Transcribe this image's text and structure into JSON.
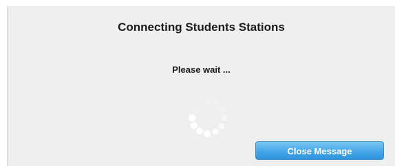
{
  "dialog": {
    "title": "Connecting Students Stations",
    "message": "Please wait ...",
    "spinner_icon": "loading-spinner-icon",
    "close_button_label": "Close Message"
  },
  "colors": {
    "dialog_background": "#efefef",
    "button_blue": "#4aa9e8",
    "spinner_dot": "#ffffff"
  }
}
